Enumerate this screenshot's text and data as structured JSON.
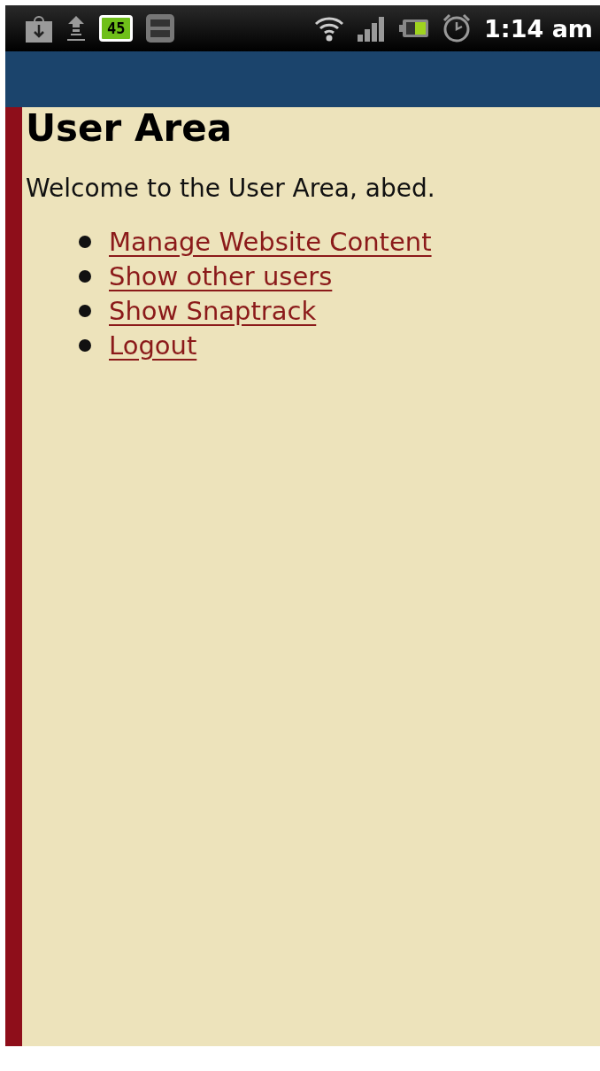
{
  "status_bar": {
    "badge": "45",
    "time": "1:14 am"
  },
  "page": {
    "title": "User Area",
    "welcome": "Welcome to the User Area, abed.",
    "links": [
      "Manage Website Content",
      "Show other users",
      "Show Snaptrack",
      "Logout"
    ]
  }
}
